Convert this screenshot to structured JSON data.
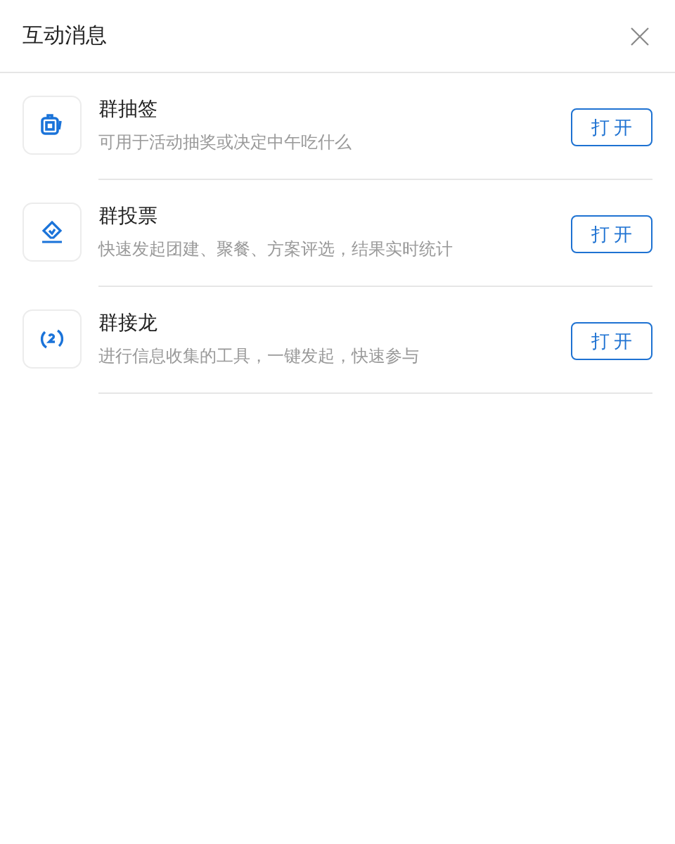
{
  "dialog": {
    "title": "互动消息"
  },
  "apps": [
    {
      "kind": "lottery",
      "name": "群抽签",
      "description": "可用于活动抽奖或决定中午吃什么",
      "button": "打开"
    },
    {
      "kind": "vote",
      "name": "群投票",
      "description": "快速发起团建、聚餐、方案评选，结果实时统计",
      "button": "打开"
    },
    {
      "kind": "relay",
      "name": "群接龙",
      "description": "进行信息收集的工具，一键发起，快速参与",
      "button": "打开"
    }
  ]
}
